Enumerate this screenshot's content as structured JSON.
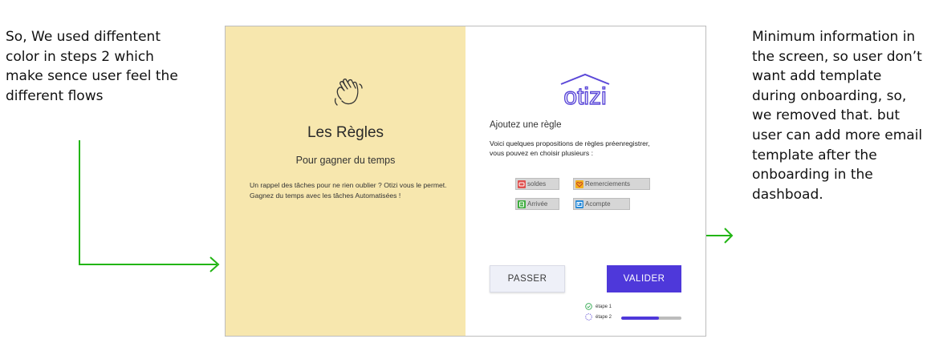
{
  "notes": {
    "left": "So, We used diffentent color in steps 2 which make sence user feel the different flows",
    "right": "Minimum information in the screen, so user don’t want add template during onboarding, so, we removed that. but user can add more email template after the onboarding in the dashboad."
  },
  "left_panel": {
    "icon": "waving-hand-icon",
    "title": "Les Règles",
    "subtitle": "Pour gagner du temps",
    "description": "Un rappel des tâches pour ne rien oublier ? Otizi vous le permet. Gagnez du temps avec les tâches Automatisées !"
  },
  "right_panel": {
    "logo_text": "otizi",
    "heading": "Ajoutez une règle",
    "description": "Voici quelques propositions de règles préenregistrer, vous pouvez en choisir plusieurs :",
    "rules": [
      {
        "label": "soldes",
        "icon": "sale-tag-icon",
        "color": "#e0504e"
      },
      {
        "label": "Remerciements",
        "icon": "heart-icon",
        "color": "#f2b01e"
      },
      {
        "label": "Arrivée",
        "icon": "arrival-icon",
        "color": "#3fae3f"
      },
      {
        "label": "Acompte",
        "icon": "deposit-icon",
        "color": "#2a8bd8"
      }
    ],
    "skip_label": "PASSER",
    "validate_label": "VALIDER",
    "steps": [
      {
        "label": "étape 1",
        "state": "done"
      },
      {
        "label": "étape 2",
        "state": "current"
      }
    ],
    "progress": 0.62
  },
  "colors": {
    "accent": "#4e38da",
    "left_bg": "#f7e7ae",
    "arrow": "#22b514"
  }
}
